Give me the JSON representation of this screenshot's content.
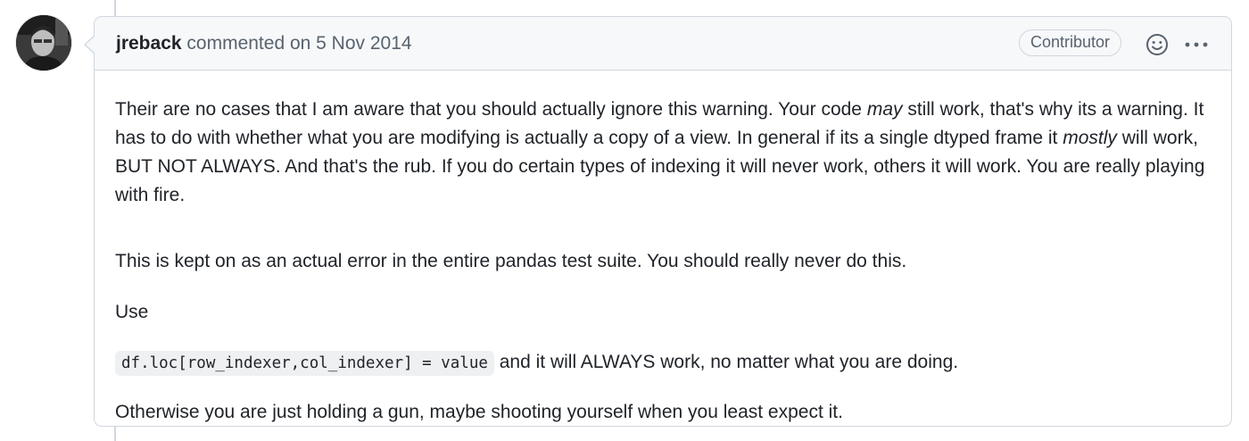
{
  "comment": {
    "author": "jreback",
    "action_text": "commented on",
    "date": "5 Nov 2014",
    "role_badge": "Contributor",
    "icons": {
      "reaction": "smiley-icon",
      "more": "kebab-horizontal-icon",
      "avatar": "user-avatar"
    },
    "body": {
      "p1": {
        "seg1": "Their are no cases that I am aware that you should actually ignore this warning. Your code ",
        "em1": "may",
        "seg2": " still work, that's why its a warning. It has to do with whether what you are modifying is actually a copy of a view. In general if its a single dtyped frame it ",
        "em2": "mostly",
        "seg3": " will work, BUT NOT ALWAYS. And that's the rub. If you do certain types of indexing it will never work, others it will work. You are really playing with fire."
      },
      "p2": "This is kept on as an actual error in the entire pandas test suite. You should really never do this.",
      "p3": "Use",
      "p4": {
        "code": "df.loc[row_indexer,col_indexer] = value",
        "text": " and it will ALWAYS work, no matter what you are doing."
      },
      "p5": "Otherwise you are just holding a gun, maybe shooting yourself when you least expect it."
    }
  },
  "colors": {
    "border": "#d0d7de",
    "header_bg": "#f6f8fa",
    "muted_text": "#59636e",
    "text": "#1f2328",
    "code_bg": "#eef0f2"
  }
}
